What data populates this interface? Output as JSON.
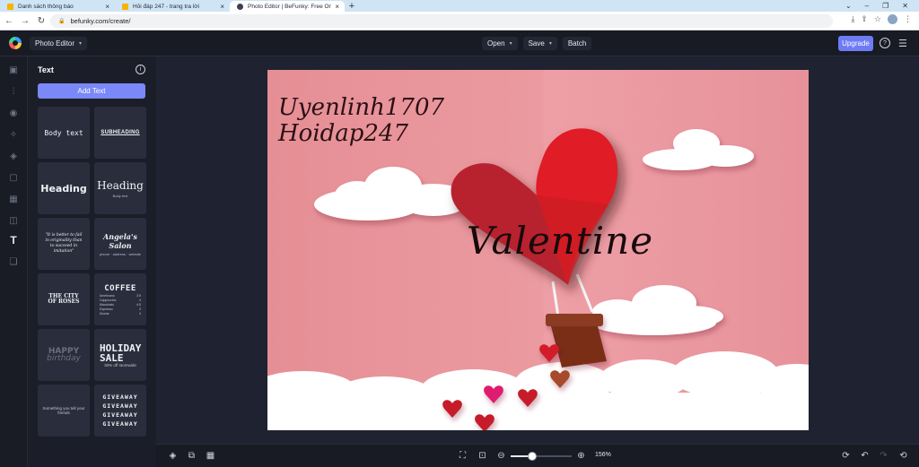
{
  "browser": {
    "tabs": [
      {
        "title": "Danh sách thông báo",
        "active": false
      },
      {
        "title": "Hỏi đáp 247 - trang tra lời",
        "active": false
      },
      {
        "title": "Photo Editor | BeFunky: Free Onl",
        "active": true
      }
    ],
    "url": "befunky.com/create/"
  },
  "app": {
    "product": "Photo Editor",
    "menu": {
      "open": "Open",
      "save": "Save",
      "batch": "Batch"
    },
    "upgrade": "Upgrade",
    "help": "?"
  },
  "panel": {
    "title": "Text",
    "add_text": "Add Text",
    "templates": {
      "body": "Body text",
      "subheading": "SUBHEADING",
      "heading1": "Heading",
      "heading2": "Heading",
      "heading2_sub": "Body text",
      "quote": "\"It is better to fail in originality than to succeed in imitation\"",
      "salon": "Angela's Salon",
      "salon_sub": "phone · address · website",
      "city1": "THE CITY",
      "city2": "OF ROSES",
      "coffee": "COFFEE",
      "coffee_items": [
        {
          "name": "Americano",
          "price": "3.5"
        },
        {
          "name": "Cappuccino",
          "price": "4"
        },
        {
          "name": "Macchiato",
          "price": "4.5"
        },
        {
          "name": "Espresso",
          "price": "3"
        },
        {
          "name": "Mocha",
          "price": "4"
        }
      ],
      "happy1": "HAPPY",
      "happy2": "birthday",
      "holiday1": "HOLIDAY",
      "holiday2": "SALE",
      "holiday_sub": "30% off storewide",
      "small_text": "Something you tell your friends",
      "giveaway": "GIVEAWAY"
    }
  },
  "canvas": {
    "text_top_1": "Uyenlinh1707",
    "text_top_2": "Hoidap247",
    "text_center": "Valentine"
  },
  "zoom": {
    "value_label": "156%",
    "level": 0.35
  }
}
